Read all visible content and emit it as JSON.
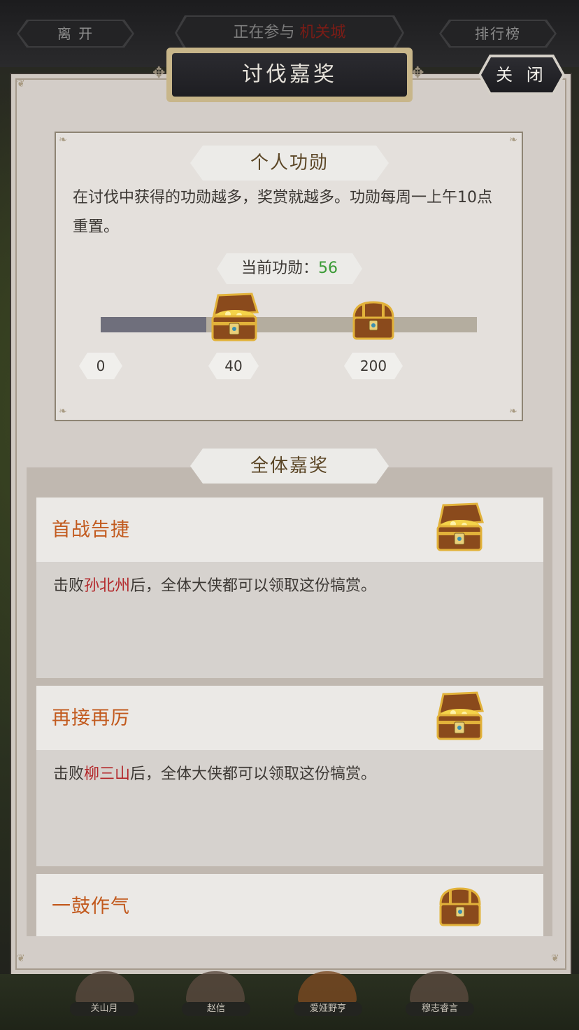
{
  "topbar": {
    "leave_label": "离 开",
    "status_prefix": "正在参与",
    "status_city": "机关城",
    "ranking_label": "排行榜"
  },
  "panel": {
    "title": "讨伐嘉奖",
    "close_label": "关 闭"
  },
  "personal": {
    "ribbon_label": "个人功勋",
    "description": "在讨伐中获得的功勋越多，奖赏就越多。功勋每周一上午10点重置。",
    "current_label": "当前功勋：",
    "current_value": "56",
    "progress_fraction": 0.28,
    "ticks": [
      "0",
      "40",
      "200"
    ]
  },
  "all_rewards": {
    "ribbon_label": "全体嘉奖",
    "cards": [
      {
        "title": "首战告捷",
        "text_prefix": "击败",
        "boss": "孙北州",
        "text_suffix": "后，全体大侠都可以领取这份犒赏。"
      },
      {
        "title": "再接再厉",
        "text_prefix": "击败",
        "boss": "柳三山",
        "text_suffix": "后，全体大侠都可以领取这份犒赏。"
      },
      {
        "title": "一鼓作气"
      }
    ]
  },
  "bottom": {
    "names": [
      "关山月",
      "赵信",
      "爱娅野亨",
      "穆志睿言"
    ]
  },
  "colors": {
    "accent_orange": "#c25a1e",
    "boss_red": "#b3272a",
    "merit_green": "#3a9a35",
    "panel_bg": "#d3cdc8"
  }
}
